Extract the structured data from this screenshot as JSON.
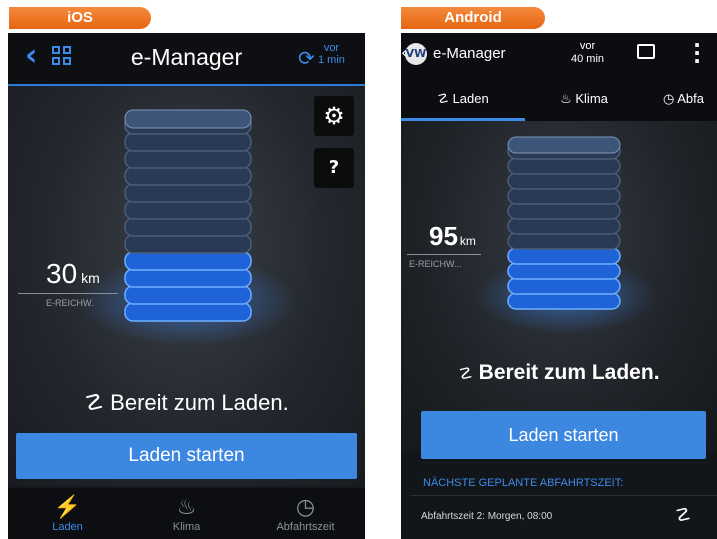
{
  "labels": {
    "ios": "iOS",
    "android": "Android"
  },
  "ios": {
    "nav": {
      "back": "‹",
      "title": "e-Manager",
      "sync_line1": "vor",
      "sync_line2": "1 min"
    },
    "range": {
      "value": "30",
      "unit": "km",
      "label": "E-REICHW."
    },
    "status": "Bereit zum Laden.",
    "primary_button": "Laden starten",
    "tabs": [
      {
        "label": "Laden",
        "icon": "charging-plug-icon"
      },
      {
        "label": "Klima",
        "icon": "seat-climate-icon"
      },
      {
        "label": "Abfahrtszeit",
        "icon": "departure-clock-icon"
      }
    ],
    "side_buttons": {
      "settings": "⚙",
      "help": "?"
    },
    "colors": {
      "accent": "#3d8be8",
      "button": "#3c87e0",
      "glow": "#2f7bff"
    }
  },
  "android": {
    "nav": {
      "back": "‹",
      "logo": "VW",
      "title": "e-Manager",
      "sync_line1": "vor",
      "sync_line2": "40 min"
    },
    "tabs": [
      {
        "label": "Laden",
        "icon": "charging-plug-icon"
      },
      {
        "label": "Klima",
        "icon": "seat-climate-icon"
      },
      {
        "label": "Abfa",
        "icon": "departure-clock-icon"
      }
    ],
    "range": {
      "value": "95",
      "unit": "km",
      "label": "E-REICHW..."
    },
    "status": "Bereit zum Laden.",
    "primary_button": "Laden starten",
    "section_title": "NÄCHSTE GEPLANTE ABFAHRTSZEIT:",
    "departure_row": "Abfahrtszeit 2: Morgen, 08:00"
  }
}
